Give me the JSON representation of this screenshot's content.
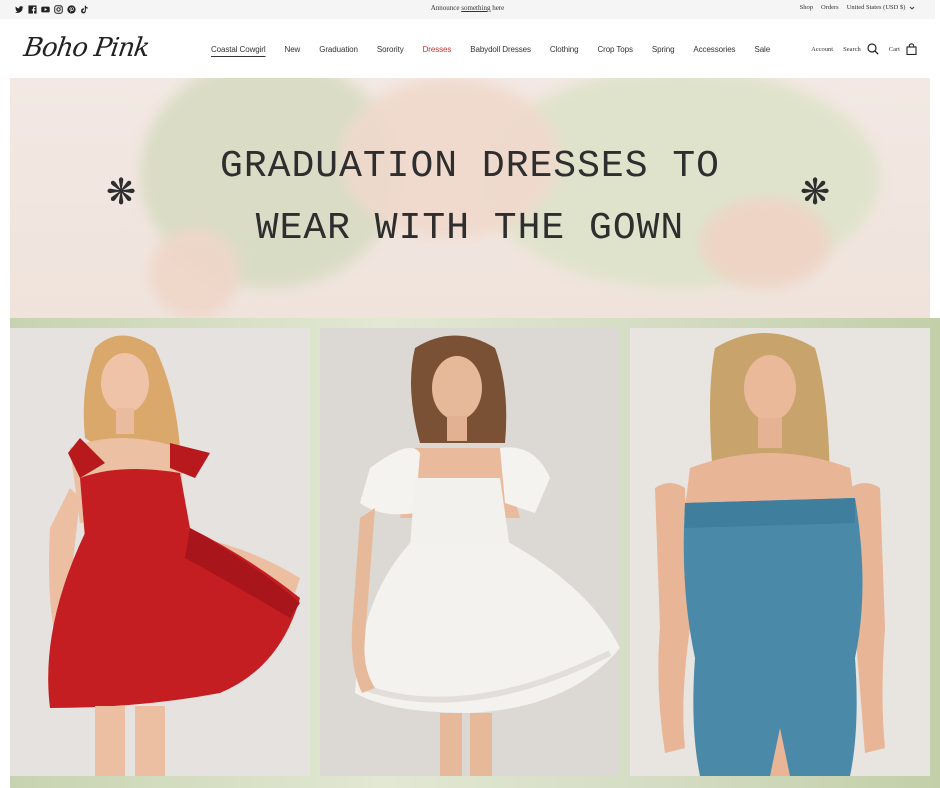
{
  "announcement": {
    "text_before": "Announce",
    "text_link": "something",
    "text_after": "here"
  },
  "social_icons": [
    "twitter-icon",
    "facebook-icon",
    "youtube-icon",
    "instagram-icon",
    "pinterest-icon",
    "tiktok-icon"
  ],
  "utility_links": {
    "shop": "Shop",
    "orders": "Orders",
    "currency": "United States (USD $)"
  },
  "brand": {
    "logo_text": "Boho Pink"
  },
  "nav": {
    "items": [
      "Coastal Cowgirl",
      "New",
      "Graduation",
      "Sorority",
      "Dresses",
      "Babydoll Dresses",
      "Clothing",
      "Crop Tops",
      "Spring",
      "Accessories",
      "Sale"
    ],
    "active": "Coastal Cowgirl",
    "highlighted": "Dresses",
    "highlight_color": "#c8302c"
  },
  "header_actions": {
    "account": "Account",
    "search": "Search",
    "cart": "Cart"
  },
  "hero": {
    "line1": "GRADUATION DRESSES TO",
    "line2": "WEAR WITH THE GOWN",
    "star_left": "❋",
    "star_right": "❋"
  },
  "products": [
    {
      "color_name": "red",
      "dress_color": "#c41e22"
    },
    {
      "color_name": "white",
      "dress_color": "#f4f2ef"
    },
    {
      "color_name": "blue",
      "dress_color": "#4a8aa8"
    }
  ]
}
